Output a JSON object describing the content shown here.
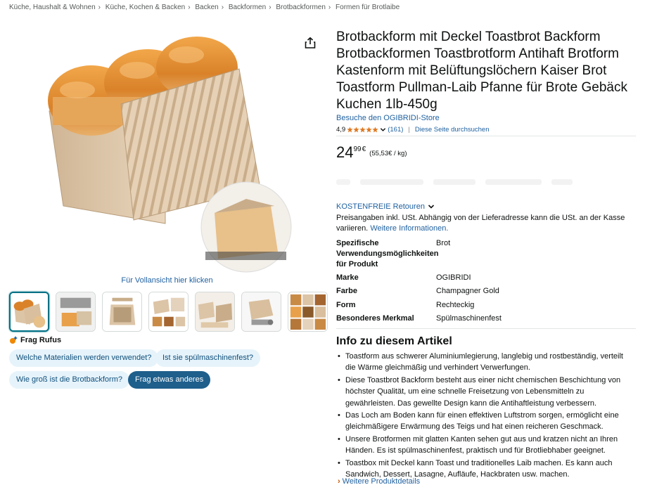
{
  "breadcrumb": [
    "Küche, Haushalt & Wohnen",
    "Küche, Kochen & Backen",
    "Backen",
    "Backformen",
    "Brotbackformen",
    "Formen für Brotlaibe"
  ],
  "gallery": {
    "fullview_text": "Für Vollansicht hier klicken",
    "thumbnail_count": 7,
    "active_thumbnail": 1
  },
  "rufus": {
    "title": "Frag Rufus",
    "questions": [
      "Welche Materialien werden verwendet?",
      "Ist sie spülmaschinenfest?",
      "Wie groß ist die Brotbackform?"
    ],
    "ask_other": "Frag etwas anderes"
  },
  "product": {
    "title": "Brotbackform mit Deckel Toastbrot Backform Brotbackformen Toastbrotform Antihaft Brotform Kastenform mit Belüftungslöchern Kaiser Brot Toastform Pullman-Laib Pfanne für Brote Gebäck Kuchen 1lb-450g",
    "store_link": "Besuche den OGIBRIDI-Store",
    "rating": "4,9",
    "rating_stars": 4.9,
    "rating_count": "(161)",
    "search_page": "Diese Seite durchsuchen",
    "price_whole": "24",
    "price_fraction": "99",
    "price_currency": "€",
    "unit_price": "(55,53€ / kg)",
    "returns": "KOSTENFREIE Retouren",
    "tax_note_text": "Preisangaben inkl. USt. Abhängig von der Lieferadresse kann die USt. an der Kasse variieren.",
    "tax_note_link": "Weitere Informationen."
  },
  "specs": [
    {
      "key": "Spezifische Verwendungsmöglichkeiten für Produkt",
      "value": "Brot"
    },
    {
      "key": "Marke",
      "value": "OGIBRIDI"
    },
    {
      "key": "Farbe",
      "value": "Champagner Gold"
    },
    {
      "key": "Form",
      "value": "Rechteckig"
    },
    {
      "key": "Besonderes Merkmal",
      "value": "Spülmaschinenfest"
    }
  ],
  "about": {
    "heading": "Info zu diesem Artikel",
    "bullets": [
      "Toastform aus schwerer Aluminiumlegierung, langlebig und rostbeständig, verteilt die Wärme gleichmäßig und verhindert Verwerfungen.",
      "Diese Toastbrot Backform besteht aus einer nicht chemischen Beschichtung von höchster Qualität, um eine schnelle Freisetzung von Lebensmitteln zu gewährleisten. Das gewellte Design kann die Antihaftleistung verbessern.",
      "Das Loch am Boden kann für einen effektiven Luftstrom sorgen, ermöglicht eine gleichmäßigere Erwärmung des Teigs und hat einen reicheren Geschmack.",
      "Unsere Brotformen mit glatten Kanten sehen gut aus und kratzen nicht an Ihren Händen. Es ist spülmaschinenfest, praktisch und für Brotliebhaber geeignet.",
      "Toastbox mit Deckel kann Toast und traditionelles Laib machen. Es kann auch Sandwich, Dessert, Lasagne, Aufläufe, Hackbraten usw. machen."
    ],
    "more_link": "Weitere Produktdetails"
  },
  "colors": {
    "link": "#2162a1",
    "star": "#de7921",
    "pan_gold": "#dcc4a6",
    "bread": "#d98a2f",
    "chip_bg": "#e6f3fb",
    "chip_dark": "#1e5f8c"
  }
}
